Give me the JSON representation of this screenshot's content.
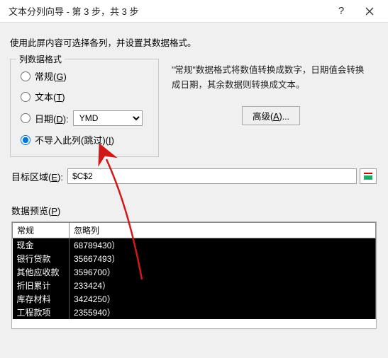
{
  "title": "文本分列向导 - 第 3 步，共 3 步",
  "instruction": "使用此屏内容可选择各列，并设置其数据格式。",
  "fieldset": {
    "legend": "列数据格式",
    "opt_general": "常规(",
    "opt_general_u": "G",
    "opt_general_tail": ")",
    "opt_text": "文本(",
    "opt_text_u": "T",
    "opt_text_tail": ")",
    "opt_date": "日期(",
    "opt_date_u": "D",
    "opt_date_tail": "):",
    "date_combo": "YMD",
    "opt_skip": "不导入此列(跳过)(",
    "opt_skip_u": "I",
    "opt_skip_tail": ")"
  },
  "right_desc": "\"常规\"数据格式将数值转换成数字，日期值会转换成日期，其余数据则转换成文本。",
  "advanced_btn": "高级(",
  "advanced_btn_u": "A",
  "advanced_btn_tail": ")...",
  "dest_label": "目标区域(",
  "dest_label_u": "E",
  "dest_label_tail": "):",
  "dest_value": "$C$2",
  "preview_label": "数据预览(",
  "preview_label_u": "P",
  "preview_label_tail": ")",
  "preview": {
    "headers": [
      "常规",
      "忽略列"
    ],
    "rows": [
      [
        "现金",
        "68789430）"
      ],
      [
        "银行贷款",
        "35667493）"
      ],
      [
        "其他应收款",
        "3596700）"
      ],
      [
        "折旧累计",
        "233424）"
      ],
      [
        "库存材料",
        "3424250）"
      ],
      [
        "工程款项",
        "2355940）"
      ]
    ]
  }
}
